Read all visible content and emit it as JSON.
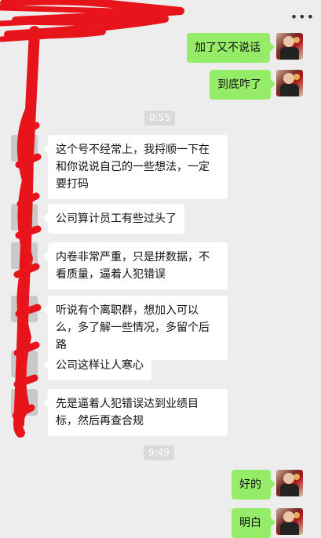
{
  "header": {
    "more_icon": "more-dots-icon",
    "more_label": "•••"
  },
  "messages": [
    {
      "side": "out",
      "text": "加了又不说话"
    },
    {
      "side": "out",
      "text": "到底咋了"
    },
    {
      "side": "time",
      "text": "0:55"
    },
    {
      "side": "in",
      "text": "这个号不经常上，我捋顺一下在和你说说自己的一些想法，一定要打码"
    },
    {
      "side": "in",
      "text": "公司算计员工有些过头了"
    },
    {
      "side": "in",
      "text": "内卷非常严重，只是拼数据，不看质量，逼着人犯错误"
    },
    {
      "side": "in",
      "text": "听说有个离职群，想加入可以么，多了解一些情况，多留个后路"
    },
    {
      "side": "in",
      "text": "公司这样让人寒心"
    },
    {
      "side": "in",
      "text": "先是逼着人犯错误达到业绩目标，然后再查合规"
    },
    {
      "side": "time",
      "text": "9:49"
    },
    {
      "side": "out",
      "text": "好的"
    },
    {
      "side": "out",
      "text": "明白"
    }
  ],
  "colors": {
    "background": "#ededed",
    "bubble_out": "#95ec69",
    "bubble_in": "#ffffff",
    "redaction": "#e8141c"
  }
}
